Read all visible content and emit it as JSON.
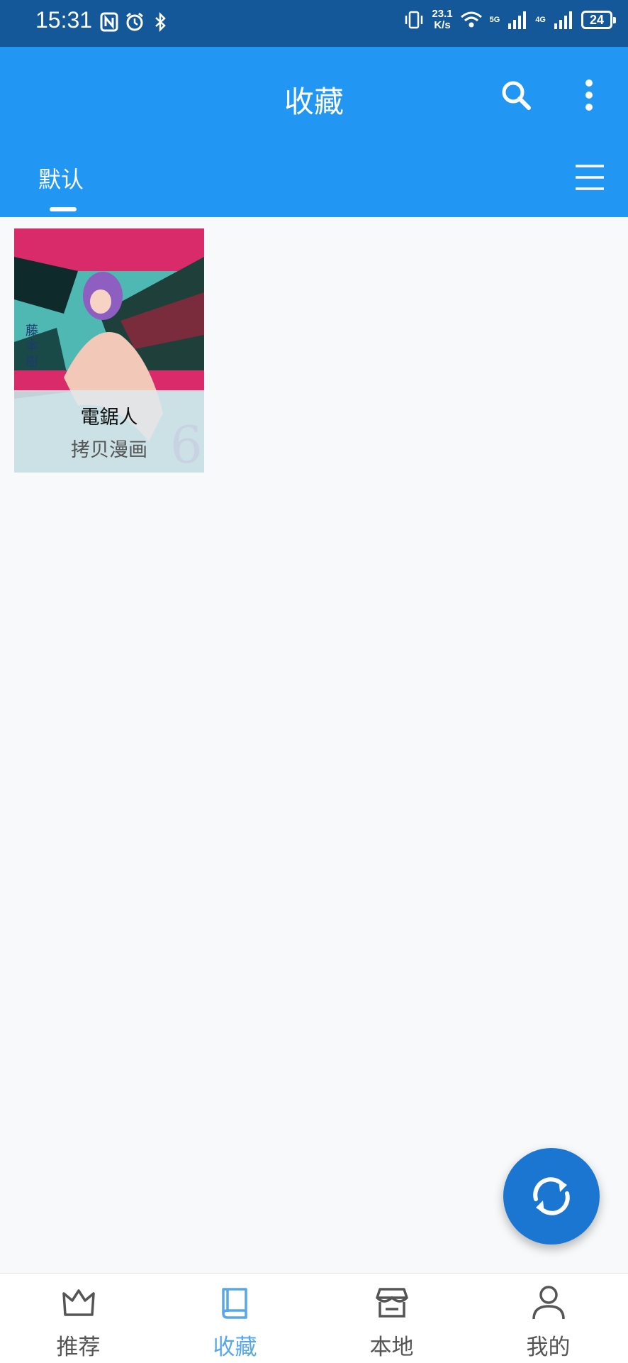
{
  "status_bar": {
    "time": "15:31",
    "net_speed_value": "23.1",
    "net_speed_unit": "K/s",
    "network_5g": "5G",
    "network_4g": "4G",
    "battery": "24"
  },
  "header": {
    "title": "收藏"
  },
  "tabs": [
    {
      "label": "默认",
      "active": true
    }
  ],
  "favorites": [
    {
      "title": "電鋸人",
      "source": "拷贝漫画"
    }
  ],
  "bottom_nav": [
    {
      "label": "推荐",
      "icon": "crown-icon",
      "active": false
    },
    {
      "label": "收藏",
      "icon": "book-icon",
      "active": true
    },
    {
      "label": "本地",
      "icon": "store-icon",
      "active": false
    },
    {
      "label": "我的",
      "icon": "person-icon",
      "active": false
    }
  ],
  "colors": {
    "primary": "#2196f3",
    "status_bar": "#14589a",
    "fab": "#1b76d2",
    "active_nav": "#57a8e8"
  }
}
